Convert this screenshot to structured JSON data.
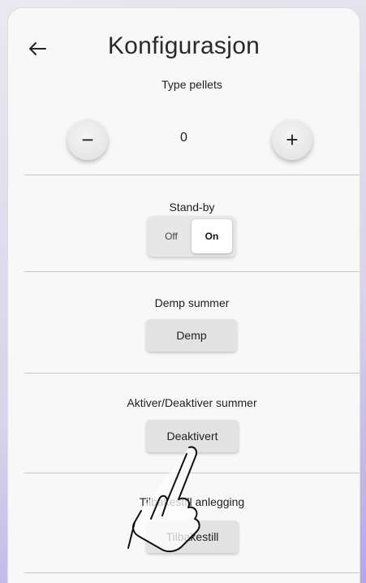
{
  "header": {
    "title": "Konfigurasjon",
    "back_icon": "arrow-left-icon"
  },
  "type_pellets": {
    "label": "Type pellets",
    "value": "0",
    "minus": "−",
    "plus": "+"
  },
  "standby": {
    "label": "Stand-by",
    "off": "Off",
    "on": "On",
    "selected": "On"
  },
  "demp_summer": {
    "label": "Demp summer",
    "button": "Demp"
  },
  "aktiver_summer": {
    "label": "Aktiver/Deaktiver summer",
    "button": "Deaktivert"
  },
  "tilbakestill": {
    "label": "Tilbakestill anlegging",
    "button": "Tilbakestill"
  },
  "overlay": {
    "icon": "pointing-hand-icon"
  }
}
